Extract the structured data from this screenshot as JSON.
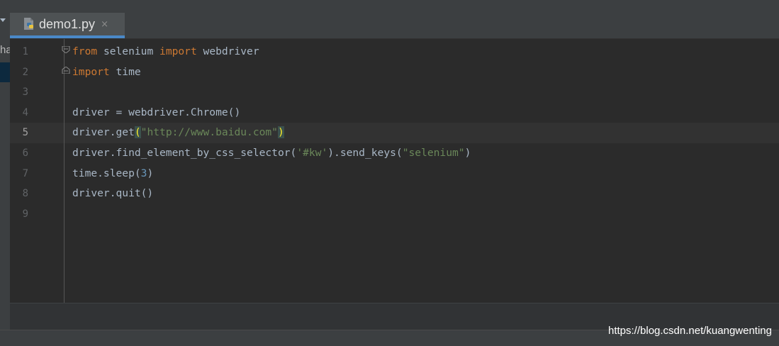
{
  "sidebar": {
    "cut_text": "ha"
  },
  "tab": {
    "filename": "demo1.py",
    "close_glyph": "×",
    "icon": "python-file-icon"
  },
  "editor": {
    "current_line": 5,
    "line_numbers": [
      "1",
      "2",
      "3",
      "4",
      "5",
      "6",
      "7",
      "8",
      "9"
    ],
    "lines": [
      [
        {
          "t": "from",
          "c": "kw"
        },
        {
          "t": " selenium "
        },
        {
          "t": "import",
          "c": "kw"
        },
        {
          "t": " webdriver"
        }
      ],
      [
        {
          "t": "import",
          "c": "kw"
        },
        {
          "t": " time"
        }
      ],
      [],
      [
        {
          "t": "driver = webdriver.Chrome()"
        }
      ],
      [
        {
          "t": "driver.get"
        },
        {
          "t": "(",
          "c": "brk"
        },
        {
          "t": "\"http://www.baidu.com\"",
          "c": "str"
        },
        {
          "t": ")",
          "c": "brk"
        }
      ],
      [
        {
          "t": "driver.find_element_by_css_selector("
        },
        {
          "t": "'#kw'",
          "c": "str"
        },
        {
          "t": ").send_keys("
        },
        {
          "t": "\"selenium\"",
          "c": "str"
        },
        {
          "t": ")"
        }
      ],
      [
        {
          "t": "time.sleep("
        },
        {
          "t": "3",
          "c": "num"
        },
        {
          "t": ")"
        }
      ],
      [
        {
          "t": "driver.quit()"
        }
      ],
      []
    ]
  },
  "watermark": "https://blog.csdn.net/kuangwenting",
  "colors": {
    "keyword": "#cc7832",
    "string": "#6a8759",
    "number": "#6897bb",
    "tab_underline": "#4a88c7"
  }
}
